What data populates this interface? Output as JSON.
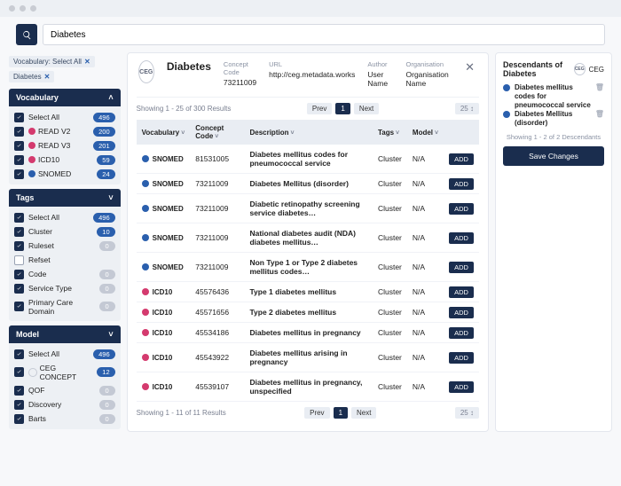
{
  "search": {
    "value": "Diabetes"
  },
  "chips": [
    {
      "label": "Vocabulary: Select All"
    },
    {
      "label": "Diabetes"
    }
  ],
  "sidebar": {
    "vocab": {
      "title": "Vocabulary",
      "items": [
        {
          "label": "Select All",
          "count": "496",
          "checked": true,
          "color": ""
        },
        {
          "label": "READ V2",
          "count": "200",
          "checked": true,
          "color": "vred"
        },
        {
          "label": "READ V3",
          "count": "201",
          "checked": true,
          "color": "vred"
        },
        {
          "label": "ICD10",
          "count": "59",
          "checked": true,
          "color": "vred"
        },
        {
          "label": "SNOMED",
          "count": "24",
          "checked": true,
          "color": "vblue"
        }
      ]
    },
    "tags": {
      "title": "Tags",
      "items": [
        {
          "label": "Select All",
          "count": "496",
          "checked": true
        },
        {
          "label": "Cluster",
          "count": "10",
          "checked": true
        },
        {
          "label": "Ruleset",
          "count": "0",
          "checked": true,
          "grey": true
        },
        {
          "label": "Refset",
          "count": "",
          "checked": false
        },
        {
          "label": "Code",
          "count": "0",
          "checked": true,
          "grey": true
        },
        {
          "label": "Service Type",
          "count": "0",
          "checked": true,
          "grey": true
        },
        {
          "label": "Primary Care Domain",
          "count": "0",
          "checked": true,
          "grey": true
        }
      ]
    },
    "model": {
      "title": "Model",
      "items": [
        {
          "label": "Select All",
          "count": "496",
          "checked": true
        },
        {
          "label": "CEG CONCEPT",
          "count": "12",
          "checked": true,
          "logo": true
        },
        {
          "label": "QOF",
          "count": "0",
          "checked": true,
          "grey": true
        },
        {
          "label": "Discovery",
          "count": "0",
          "checked": true,
          "grey": true
        },
        {
          "label": "Barts",
          "count": "0",
          "checked": true,
          "grey": true
        }
      ]
    }
  },
  "main": {
    "title": "Diabetes",
    "concept_code_label": "Concept Code",
    "concept_code": "73211009",
    "url_label": "URL",
    "url": "http://ceg.metadata.works",
    "author_label": "Author",
    "author": "User Name",
    "org_label": "Organisation",
    "org": "Organisation Name",
    "showing_top": "Showing 1 - 25 of 300 Results",
    "showing_bottom": "Showing 1 - 11 of 11 Results",
    "prev": "Prev",
    "next": "Next",
    "page": "1",
    "perpage_top": "25 ↕",
    "perpage_bottom": "25 ↕",
    "columns": {
      "vocab": "Vocabulary",
      "code": "Concept Code",
      "desc": "Description",
      "tags": "Tags",
      "model": "Model"
    },
    "add_label": "ADD",
    "rows": [
      {
        "vocab": "SNOMED",
        "color": "vblue",
        "code": "81531005",
        "desc": "Diabetes mellitus codes for pneumococcal service",
        "tags": "Cluster",
        "model": "N/A"
      },
      {
        "vocab": "SNOMED",
        "color": "vblue",
        "code": "73211009",
        "desc": "Diabetes Mellitus (disorder)",
        "tags": "Cluster",
        "model": "N/A"
      },
      {
        "vocab": "SNOMED",
        "color": "vblue",
        "code": "73211009",
        "desc": "Diabetic retinopathy screening service diabetes…",
        "tags": "Cluster",
        "model": "N/A"
      },
      {
        "vocab": "SNOMED",
        "color": "vblue",
        "code": "73211009",
        "desc": "National diabetes audit (NDA) diabetes mellitus…",
        "tags": "Cluster",
        "model": "N/A"
      },
      {
        "vocab": "SNOMED",
        "color": "vblue",
        "code": "73211009",
        "desc": "Non Type 1 or Type 2 diabetes mellitus codes…",
        "tags": "Cluster",
        "model": "N/A"
      },
      {
        "vocab": "ICD10",
        "color": "vred",
        "code": "45576436",
        "desc": "Type 1 diabetes mellitus",
        "tags": "Cluster",
        "model": "N/A"
      },
      {
        "vocab": "ICD10",
        "color": "vred",
        "code": "45571656",
        "desc": "Type 2 diabetes mellitus",
        "tags": "Cluster",
        "model": "N/A"
      },
      {
        "vocab": "ICD10",
        "color": "vred",
        "code": "45534186",
        "desc": "Diabetes mellitus in pregnancy",
        "tags": "Cluster",
        "model": "N/A"
      },
      {
        "vocab": "ICD10",
        "color": "vred",
        "code": "45543922",
        "desc": "Diabetes mellitus arising in pregnancy",
        "tags": "Cluster",
        "model": "N/A"
      },
      {
        "vocab": "ICD10",
        "color": "vred",
        "code": "45539107",
        "desc": "Diabetes mellitus in pregnancy, unspecified",
        "tags": "Cluster",
        "model": "N/A"
      }
    ]
  },
  "right": {
    "title": "Descendants of Diabetes",
    "items": [
      {
        "label": "Diabetes mellitus codes for pneumococcal service"
      },
      {
        "label": "Diabetes Mellitus (disorder)"
      }
    ],
    "sub": "Showing 1 - 2 of 2 Descendants",
    "save": "Save Changes",
    "brand": "CEG"
  }
}
